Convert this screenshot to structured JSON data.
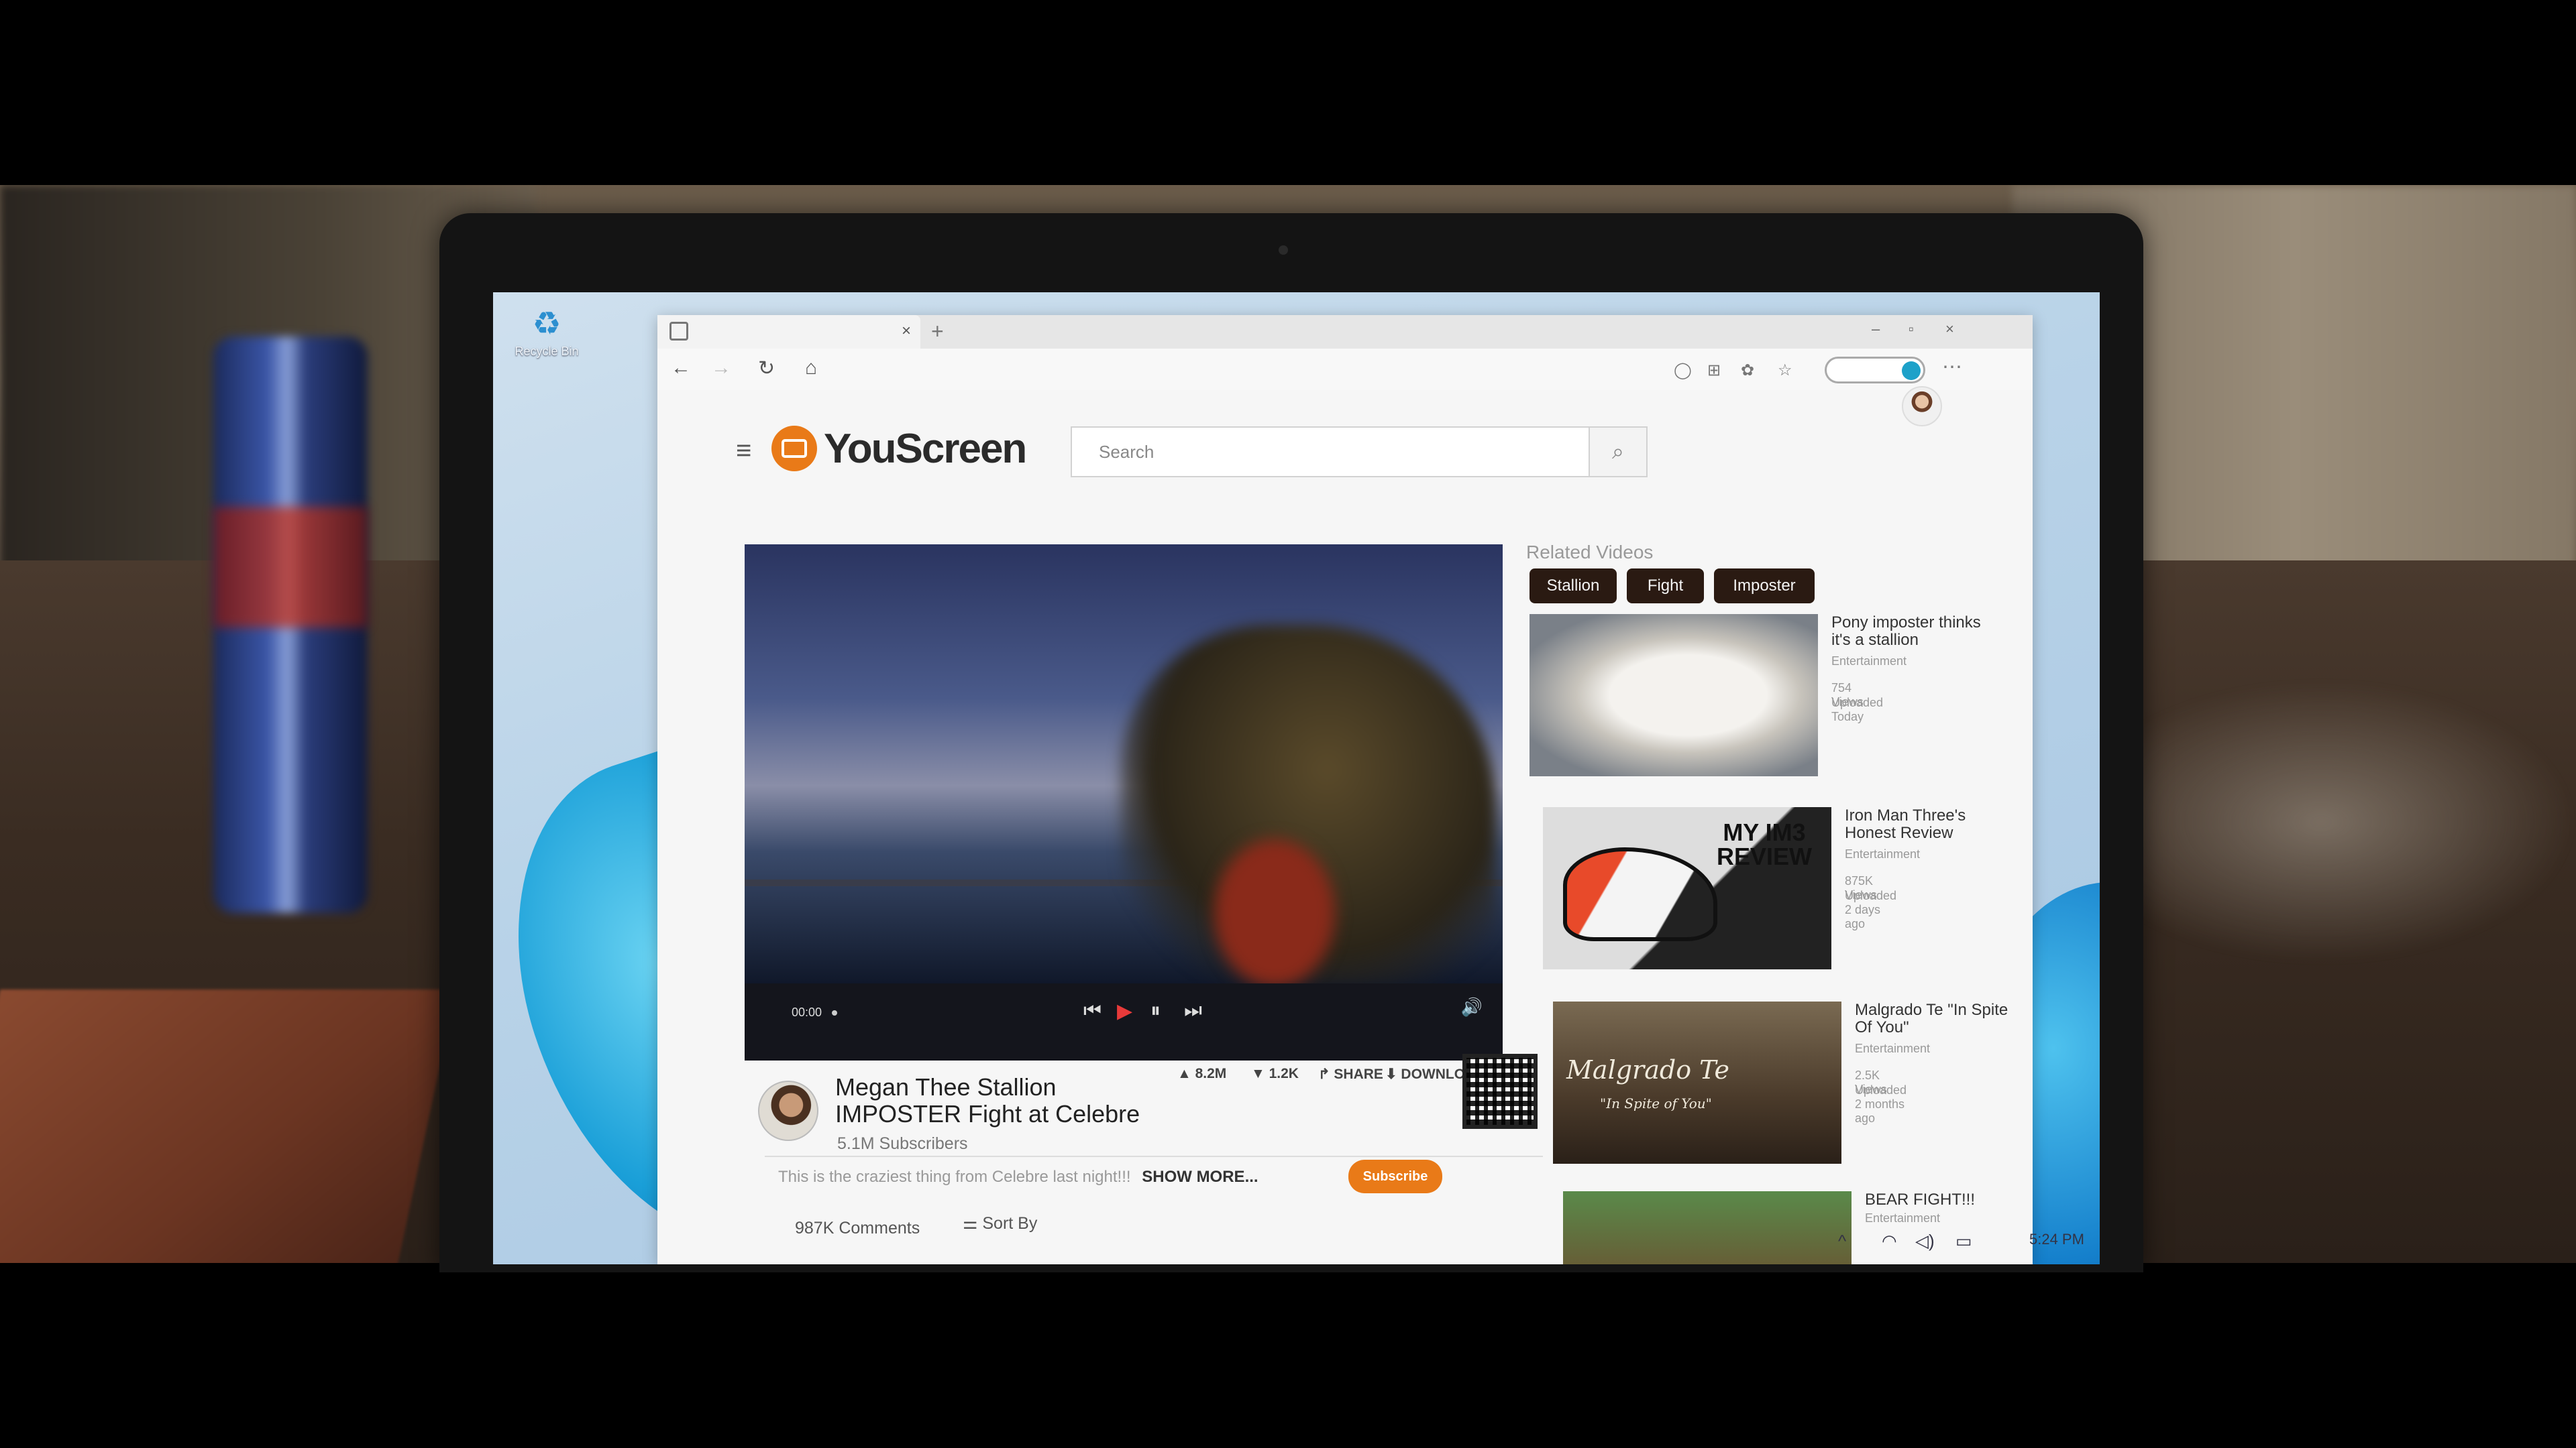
{
  "desktop": {
    "recycle_bin_label": "Recycle Bin"
  },
  "browser": {
    "tab": {
      "close_glyph": "×",
      "new_tab_glyph": "+"
    },
    "window_controls": {
      "minimize": "–",
      "maximize": "▫",
      "close": "×"
    },
    "nav": {
      "back": "←",
      "forward": "→",
      "reload": "↻",
      "home": "⌂"
    },
    "toolbar_icons": [
      "reading-view-icon",
      "apps-icon",
      "extensions-icon",
      "favorites-icon",
      "collections-icon"
    ],
    "more_glyph": "⋯",
    "toggle_color": "#1da1c9"
  },
  "site": {
    "name": "YouScreen",
    "brand_color": "#e97a18",
    "menu_glyph": "≡",
    "search": {
      "placeholder": "Search",
      "button_glyph": "⌕"
    }
  },
  "player": {
    "timecode": "00:00",
    "prev_glyph": "⏮",
    "play_glyph": "▶",
    "pause_glyph": "⏸",
    "next_glyph": "⏭",
    "volume_glyph": "🔊"
  },
  "video": {
    "channel": "Megan Thee Stallion",
    "title": "IMPOSTER Fight at Celebre",
    "subscribers": "5.1M  Subscribers",
    "likes": "▲ 8.2M",
    "dislikes": "▼ 1.2K",
    "share": "↱ SHARE",
    "download": "⬇ DOWNLOAD",
    "description": "This is the craziest thing from Celebre last night!!!",
    "show_more": "SHOW MORE...",
    "subscribe_label": "Subscribe",
    "comments_count": "987K Comments",
    "sort_by": "Sort By"
  },
  "related": {
    "heading": "Related Videos",
    "chips": [
      "Stallion",
      "Fight",
      "Imposter"
    ],
    "items": [
      {
        "title": "Pony imposter thinks it's a stallion",
        "category": "Entertainment",
        "views": "754 Views",
        "uploaded": "Uploaded Today"
      },
      {
        "title": "Iron Man Three's Honest Review",
        "category": "Entertainment",
        "views": "875K Views",
        "uploaded": "Uploaded 2 days ago",
        "thumb_text": "MY IM3 REVIEW"
      },
      {
        "title": "Malgrado Te \"In Spite Of You\"",
        "category": "Entertainment",
        "views": "2.5K Views",
        "uploaded": "Uploaded 2 months ago",
        "thumb_text": "Malgrado Te",
        "thumb_subtext": "\"In Spite of You\""
      },
      {
        "title": "BEAR FIGHT!!!",
        "category": "Entertainment"
      }
    ]
  },
  "taskbar": {
    "chevron_glyph": "^",
    "wifi_glyph": "◠",
    "volume_glyph": "◁)",
    "battery_glyph": "▭",
    "clock": "5:24 PM"
  }
}
